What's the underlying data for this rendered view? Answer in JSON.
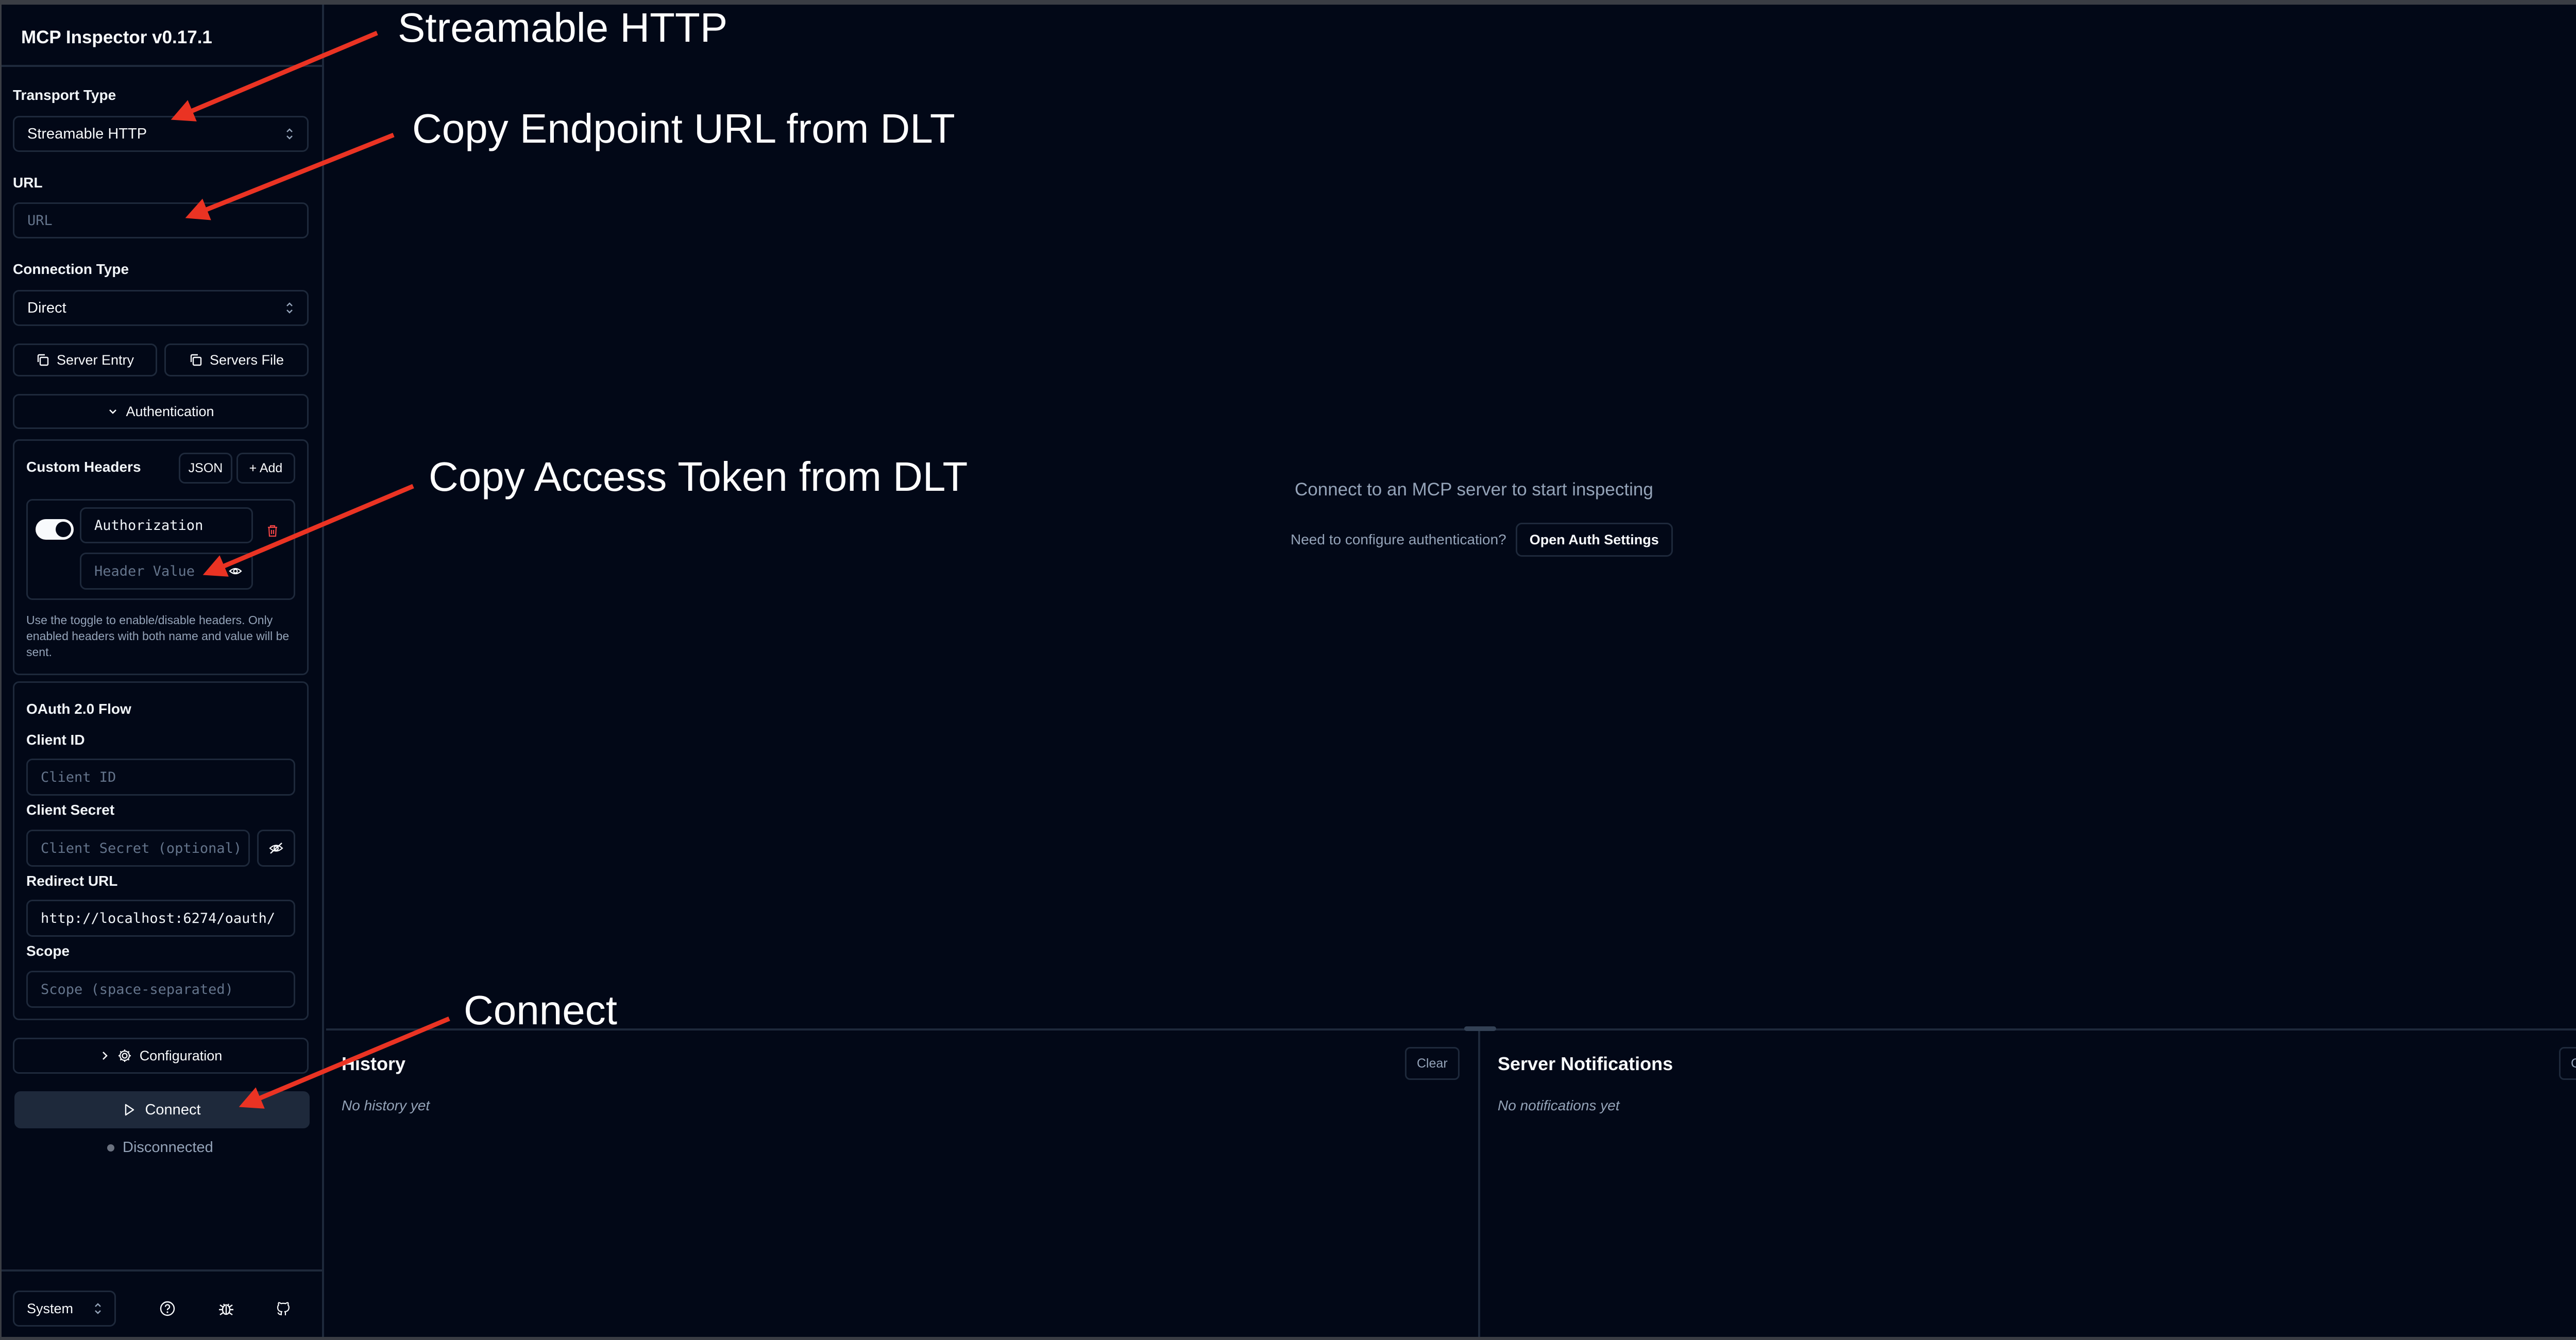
{
  "app": {
    "title": "MCP Inspector v0.17.1"
  },
  "sidebar": {
    "transport_label": "Transport Type",
    "transport_value": "Streamable HTTP",
    "url_label": "URL",
    "url_placeholder": "URL",
    "connection_label": "Connection Type",
    "connection_value": "Direct",
    "server_entry_label": "Server Entry",
    "servers_file_label": "Servers File",
    "authentication_label": "Authentication",
    "custom_headers": {
      "title": "Custom Headers",
      "json_label": "JSON",
      "add_label": "+ Add",
      "header_name": "Authorization",
      "header_value_placeholder": "Header Value",
      "hint": "Use the toggle to enable/disable headers. Only enabled headers with both name and value will be sent."
    },
    "oauth": {
      "title": "OAuth 2.0 Flow",
      "client_id_label": "Client ID",
      "client_id_placeholder": "Client ID",
      "client_secret_label": "Client Secret",
      "client_secret_placeholder": "Client Secret (optional)",
      "redirect_label": "Redirect URL",
      "redirect_value": "http://localhost:6274/oauth/",
      "scope_label": "Scope",
      "scope_placeholder": "Scope (space-separated)"
    },
    "configuration_label": "Configuration",
    "connect_label": "Connect",
    "status_text": "Disconnected",
    "theme_value": "System"
  },
  "main": {
    "empty_message": "Connect to an MCP server to start inspecting",
    "auth_prompt": "Need to configure authentication?",
    "auth_button": "Open Auth Settings"
  },
  "history": {
    "title": "History",
    "clear_label": "Clear",
    "empty_text": "No history yet"
  },
  "notifications": {
    "title": "Server Notifications",
    "clear_label": "Clear",
    "empty_text": "No notifications yet"
  },
  "annotations": {
    "streamable": "Streamable HTTP",
    "endpoint": "Copy Endpoint URL from DLT",
    "token": "Copy Access Token from DLT",
    "connect": "Connect",
    "arrow_color": "#ea3323"
  },
  "colors": {
    "background": "#020817",
    "border": "#1e293b",
    "muted": "#94a3b8",
    "danger": "#ef4444"
  }
}
